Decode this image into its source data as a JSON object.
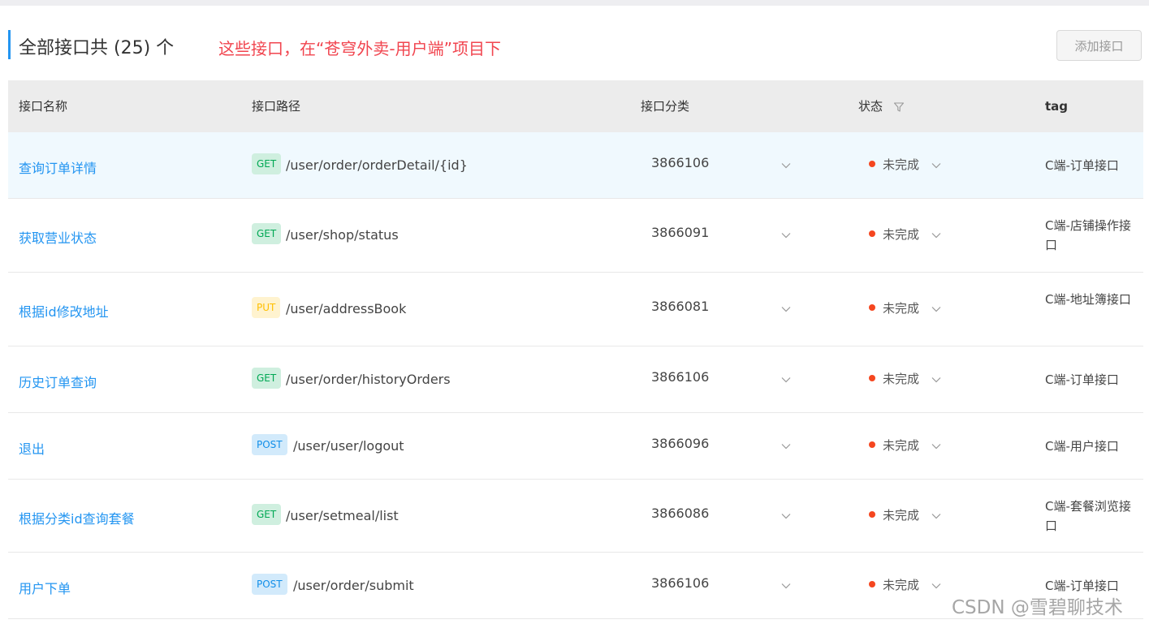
{
  "header": {
    "title": "全部接口共 (25) 个",
    "note": "这些接口，在“苍穹外卖-用户端”项目下",
    "add_button": "添加接口"
  },
  "table": {
    "columns": {
      "name": "接口名称",
      "path": "接口路径",
      "category": "接口分类",
      "status": "状态",
      "tag": "tag"
    },
    "rows": [
      {
        "name": "查询订单详情",
        "method": "GET",
        "path": "/user/order/orderDetail/{id}",
        "category": "3866106",
        "status": "未完成",
        "tag": "C端-订单接口"
      },
      {
        "name": "获取营业状态",
        "method": "GET",
        "path": "/user/shop/status",
        "category": "3866091",
        "status": "未完成",
        "tag": "C端-店铺操作接口"
      },
      {
        "name": "根据id修改地址",
        "method": "PUT",
        "path": "/user/addressBook",
        "category": "3866081",
        "status": "未完成",
        "tag": "C端-地址簿接口"
      },
      {
        "name": "历史订单查询",
        "method": "GET",
        "path": "/user/order/historyOrders",
        "category": "3866106",
        "status": "未完成",
        "tag": "C端-订单接口"
      },
      {
        "name": "退出",
        "method": "POST",
        "path": "/user/user/logout",
        "category": "3866096",
        "status": "未完成",
        "tag": "C端-用户接口"
      },
      {
        "name": "根据分类id查询套餐",
        "method": "GET",
        "path": "/user/setmeal/list",
        "category": "3866086",
        "status": "未完成",
        "tag": "C端-套餐浏览接口"
      },
      {
        "name": "用户下单",
        "method": "POST",
        "path": "/user/order/submit",
        "category": "3866106",
        "status": "未完成",
        "tag": "C端-订单接口"
      }
    ]
  },
  "watermark": "CSDN @雪碧聊技术",
  "colors": {
    "accent": "#2395f1",
    "note_red": "#f1454f",
    "status_dot": "#f5461f"
  }
}
